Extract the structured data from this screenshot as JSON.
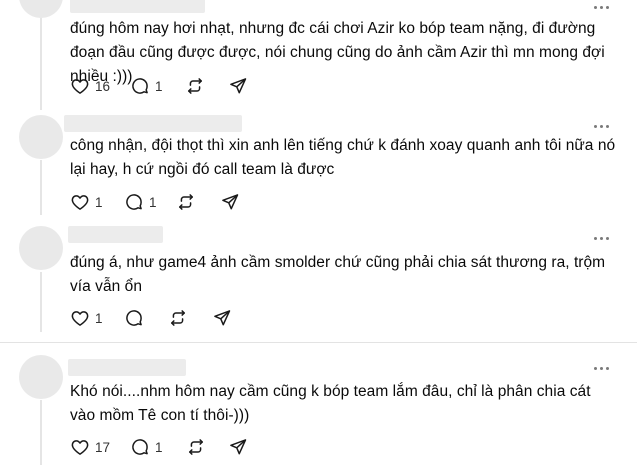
{
  "comments": [
    {
      "text": "đúng hôm nay hơi nhạt, nhưng đc cái chơi Azir ko bóp team nặng, đi đường đoạn đầu cũng được được, nói chung cũng do ảnh cầm Azir thì mn mong đợi nhiều :)))",
      "likes": "16",
      "replies": "1",
      "repost": "",
      "share": ""
    },
    {
      "text": "công nhận, đội thọt thì xin anh lên tiếng chứ k đánh xoay quanh anh tôi nữa nó lại hay, h cứ ngồi đó call team là được",
      "likes": "1",
      "replies": "1",
      "repost": "",
      "share": ""
    },
    {
      "text": "đúng á, như game4 ảnh cầm smolder chứ cũng phải chia sát thương ra, trộm vía vẫn ổn",
      "likes": "1",
      "replies": "",
      "repost": "",
      "share": ""
    },
    {
      "text": "Khó nói....nhm hôm nay cầm cũng k bóp team lắm đâu, chỉ là phân chia cát vào mồm Tê con tí thôi-)))",
      "likes": "17",
      "replies": "1",
      "repost": "",
      "share": ""
    }
  ],
  "icons": {
    "like": "heart-icon",
    "reply": "comment-icon",
    "repost": "repost-icon",
    "share": "send-icon",
    "more": "more-dots-icon"
  },
  "colors": {
    "text": "#0a0a0a",
    "icon": "#1a1a1a",
    "placeholder": "#ececec",
    "divider": "#e3e3e3"
  }
}
